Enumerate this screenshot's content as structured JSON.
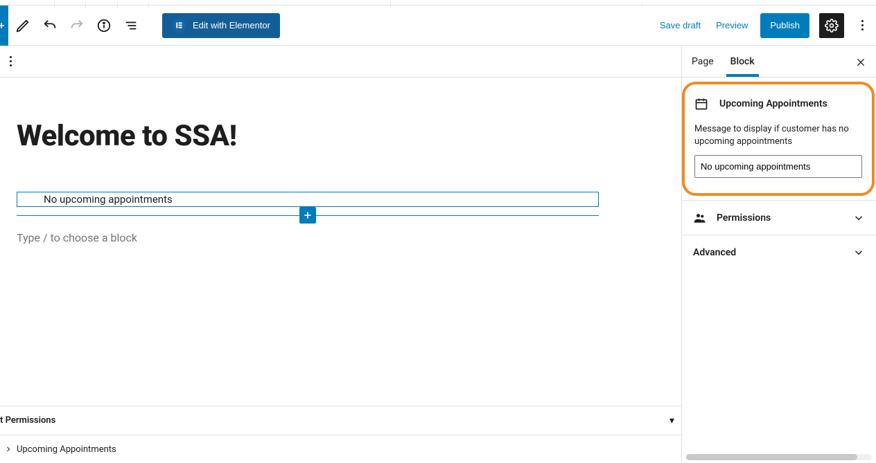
{
  "toolbar": {
    "elementor_label": "Edit with Elementor",
    "save_draft": "Save draft",
    "preview": "Preview",
    "publish": "Publish"
  },
  "editor": {
    "page_title": "Welcome to SSA!",
    "block_text": "No upcoming appointments",
    "slash_prompt": "Type / to choose a block"
  },
  "breadcrumb": {
    "permissions_label": "t Permissions",
    "upcoming_label": "Upcoming Appointments"
  },
  "sidebar": {
    "tab_page": "Page",
    "tab_block": "Block",
    "block_title": "Upcoming Appointments",
    "message_label": "Message to display if customer has no upcoming appointments",
    "message_value": "No upcoming appointments",
    "panel_permissions": "Permissions",
    "panel_advanced": "Advanced"
  }
}
